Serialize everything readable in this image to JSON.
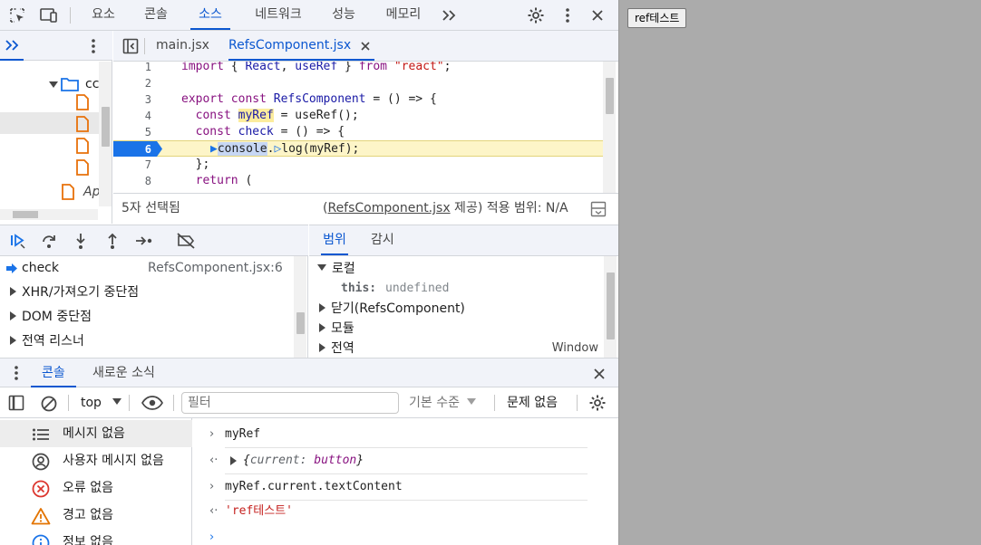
{
  "top_tabs": [
    {
      "label": "요소",
      "active": false
    },
    {
      "label": "콘솔",
      "active": false
    },
    {
      "label": "소스",
      "active": true
    },
    {
      "label": "네트워크",
      "active": false
    },
    {
      "label": "성능",
      "active": false
    },
    {
      "label": "메모리",
      "active": false
    }
  ],
  "nav_tree": {
    "folder_label": "cc",
    "file_label_partial": "Ap"
  },
  "editor_tabs": [
    {
      "label": "main.jsx",
      "active": false
    },
    {
      "label": "RefsComponent.jsx",
      "active": true
    }
  ],
  "code_lines": [
    {
      "num": "1",
      "text": "import { React, useRef } from \"react\";"
    },
    {
      "num": "2",
      "text": ""
    },
    {
      "num": "3",
      "text": "export const RefsComponent = () => {"
    },
    {
      "num": "4",
      "text": "  const myRef = useRef();"
    },
    {
      "num": "5",
      "text": "  const check = () => {"
    },
    {
      "num": "6",
      "text": "    console.log(myRef);"
    },
    {
      "num": "7",
      "text": "  };"
    },
    {
      "num": "8",
      "text": "  return ("
    }
  ],
  "status": {
    "selection": "5자 선택됨",
    "source_file": "RefsComponent.jsx",
    "source_suffix": " 제공) 적용 범위: N/A",
    "source_prefix": "("
  },
  "callstack": {
    "frame_name": "check",
    "frame_location": "RefsComponent.jsx:6"
  },
  "breakpoint_sections": [
    "XHR/가져오기 중단점",
    "DOM 중단점",
    "전역 리스너"
  ],
  "scope_tabs": [
    {
      "label": "범위",
      "active": true
    },
    {
      "label": "감시",
      "active": false
    }
  ],
  "scope": {
    "local_label": "로컬",
    "this_key": "this:",
    "this_value": "undefined",
    "closure_label": "닫기(RefsComponent)",
    "module_label": "모듈",
    "global_label": "전역",
    "global_value": "Window"
  },
  "drawer_tabs": [
    {
      "label": "콘솔",
      "active": true
    },
    {
      "label": "새로운 소식",
      "active": false
    }
  ],
  "console_toolbar": {
    "context": "top",
    "filter_placeholder": "필터",
    "level": "기본 수준",
    "issues": "문제 없음"
  },
  "console_sidebar": [
    {
      "label": "메시지 없음",
      "icon": "list-icon"
    },
    {
      "label": "사용자 메시지 없음",
      "icon": "user-icon"
    },
    {
      "label": "오류 없음",
      "icon": "error-icon"
    },
    {
      "label": "경고 없음",
      "icon": "warning-icon"
    },
    {
      "label": "정보 없음",
      "icon": "info-icon"
    }
  ],
  "console_lines": [
    {
      "sym": "›",
      "text": "myRef"
    },
    {
      "sym": "‹·",
      "text_key": "{",
      "obj_key": "current:",
      "obj_val": "button",
      "text_end": "}"
    },
    {
      "sym": "›",
      "text": "myRef.current.textContent"
    },
    {
      "sym": "‹·",
      "text": "'ref테스트'"
    }
  ],
  "page": {
    "button_label": "ref테스트"
  },
  "colors": {
    "accent": "#0b57d0",
    "highlight_line": "#fcec9d",
    "page_bg": "#ababab"
  }
}
